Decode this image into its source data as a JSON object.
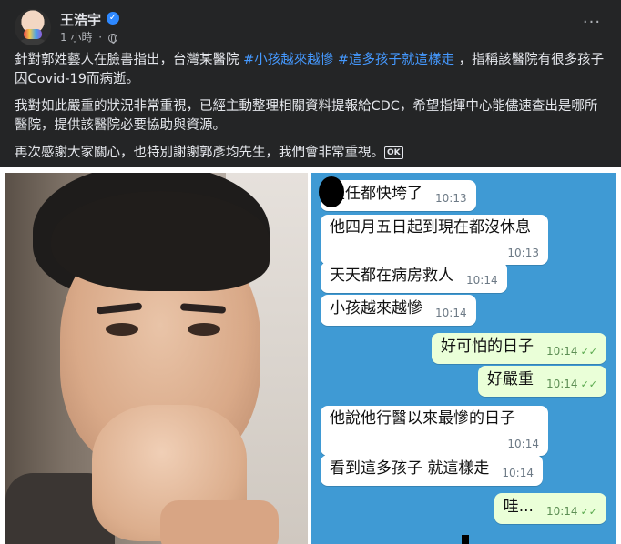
{
  "post": {
    "author": "王浩宇",
    "time": "1 小時",
    "dot": "·",
    "more": "···",
    "verified_check": "✓",
    "icons": {
      "verified": "verified-badge-icon",
      "privacy": "globe-icon",
      "more": "more-options-icon"
    },
    "p1_text1": "針對郭姓藝人在臉書指出，台灣某醫院 ",
    "hashtag1": "#小孩越來越慘",
    "hashtag2": "#這多孩子就這樣走",
    "p1_text2": " ，指稱該醫院有很多孩子因Covid-19而病逝。",
    "p2": "我對如此嚴重的狀況非常重視，已經主動整理相關資料提報給CDC，希望指揮中心能儘速查出是哪所醫院，提供該醫院必要協助與資源。",
    "p3": "再次感謝大家關心，也特別謝謝郭彥均先生，我們會非常重視。",
    "ok_emoji": "OK"
  },
  "chat": {
    "messages": [
      {
        "text": "主任都快垮了",
        "time": "10:13",
        "dir": "in"
      },
      {
        "text": "他四月五日起到現在都沒休息",
        "time": "10:13",
        "dir": "in"
      },
      {
        "text": "天天都在病房救人",
        "time": "10:14",
        "dir": "in"
      },
      {
        "text": "小孩越來越慘",
        "time": "10:14",
        "dir": "in"
      },
      {
        "text": "好可怕的日子",
        "time": "10:14",
        "dir": "out"
      },
      {
        "text": "好嚴重",
        "time": "10:14",
        "dir": "out"
      },
      {
        "text": "他說他行醫以來最慘的日子",
        "time": "10:14",
        "dir": "in"
      },
      {
        "text": "看到這多孩子 就這樣走",
        "time": "10:14",
        "dir": "in"
      },
      {
        "text": "哇...",
        "time": "10:14",
        "dir": "out"
      }
    ],
    "check_mark": "✓✓"
  },
  "colors": {
    "background": "#242526",
    "text": "#e4e6eb",
    "hashtag": "#4599ff",
    "secondary": "#b0b3b8",
    "chat_bg": "#3f9ad4"
  }
}
